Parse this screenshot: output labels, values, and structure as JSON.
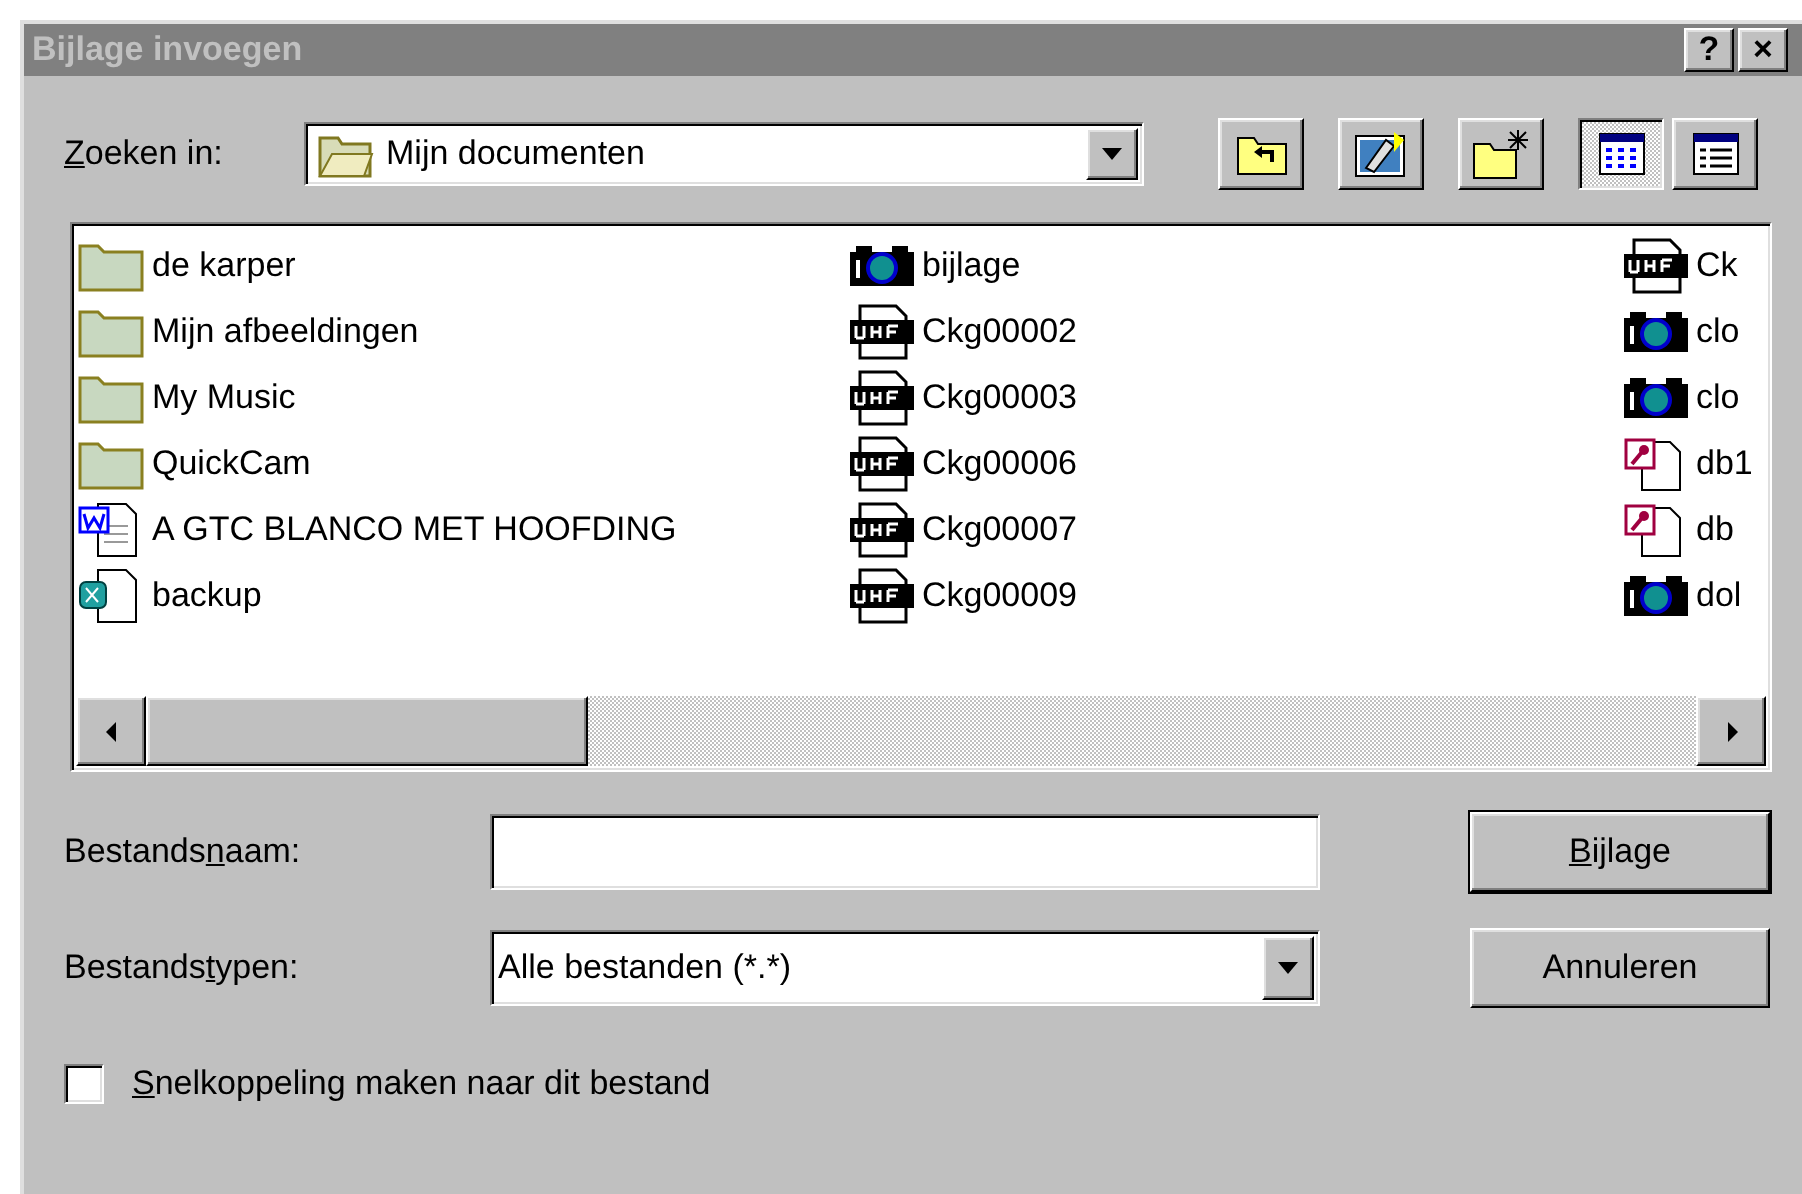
{
  "window": {
    "title": "Bijlage invoegen",
    "title_buttons": [
      "?",
      "×"
    ],
    "active": false
  },
  "look_in": {
    "access_key": "Z",
    "label_post": "oeken in:",
    "value": "Mijn documenten"
  },
  "toolbar": [
    {
      "kind": "up",
      "selected": false
    },
    {
      "kind": "desktop",
      "selected": false
    },
    {
      "kind": "new-folder",
      "selected": false
    },
    {
      "kind": "list-view",
      "selected": true
    },
    {
      "kind": "details-view",
      "selected": false
    }
  ],
  "file_list": {
    "columns": [
      [
        {
          "kind": "folder",
          "name": "de karper"
        },
        {
          "kind": "folder",
          "name": "Mijn afbeeldingen"
        },
        {
          "kind": "folder",
          "name": "My Music"
        },
        {
          "kind": "folder",
          "name": "QuickCam"
        },
        {
          "kind": "word",
          "name": "A GTC BLANCO MET HOOFDING"
        },
        {
          "kind": "backup",
          "name": "backup"
        }
      ],
      [
        {
          "kind": "camera",
          "name": "bijlage"
        },
        {
          "kind": "whf",
          "name": "Ckg00002"
        },
        {
          "kind": "whf",
          "name": "Ckg00003"
        },
        {
          "kind": "whf",
          "name": "Ckg00006"
        },
        {
          "kind": "whf",
          "name": "Ckg00007"
        },
        {
          "kind": "whf",
          "name": "Ckg00009"
        }
      ],
      [
        {
          "kind": "whf",
          "name": "Ck"
        },
        {
          "kind": "camera",
          "name": "clo"
        },
        {
          "kind": "camera",
          "name": "clo"
        },
        {
          "kind": "access",
          "name": "db1"
        },
        {
          "kind": "access",
          "name": "db"
        },
        {
          "kind": "camera",
          "name": "dol"
        }
      ]
    ]
  },
  "file_name": {
    "label_pre": "Bestands",
    "access_key": "n",
    "label_post": "aam:"
  },
  "file_type": {
    "label_pre": "Bestands",
    "access_key": "t",
    "label_post": "ypen:",
    "value": "Alle bestanden (*.*)"
  },
  "buttons": [
    {
      "access_key": "B",
      "label_post": "ijlage",
      "default": true
    },
    {
      "label_post": "Annuleren",
      "default": false
    }
  ],
  "shortcut_checkbox": {
    "access_key": "S",
    "label_post": "nelkoppeling maken naar dit bestand",
    "checked": false
  }
}
